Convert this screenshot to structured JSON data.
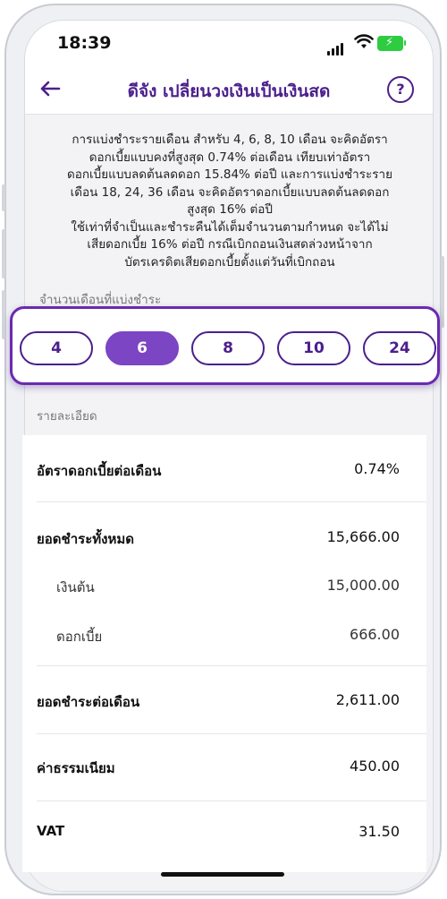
{
  "status": {
    "time": "18:39"
  },
  "nav": {
    "title": "ดีจัง เปลี่ยนวงเงินเป็นเงินสด",
    "help": "?"
  },
  "description": [
    "การแบ่งชำระรายเดือน สำหรับ 4, 6, 8, 10 เดือน จะคิดอัตรา",
    "ดอกเบี้ยแบบคงที่สูงสุด 0.74% ต่อเดือน เทียบเท่าอัตรา",
    "ดอกเบี้ยแบบลดต้นลดดอก 15.84% ต่อปี และการแบ่งชำระราย",
    "เดือน 18, 24, 36 เดือน จะคิดอัตราดอกเบี้ยแบบลดต้นลดดอก",
    "สูงสุด 16% ต่อปี",
    "ใช้เท่าที่จำเป็นและชำระคืนได้เต็มจำนวนตามกำหนด จะได้ไม่",
    "เสียดอกเบี้ย 16% ต่อปี กรณีเบิกถอนเงินสดล่วงหน้าจาก",
    "บัตรเครดิตเสียดอกเบี้ยตั้งแต่วันที่เบิกถอน"
  ],
  "months": {
    "label": "จำนวนเดือนที่แบ่งชำระ",
    "options": [
      "4",
      "6",
      "8",
      "10",
      "24"
    ],
    "selected": "6"
  },
  "details": {
    "label": "รายละเอียด",
    "rows": [
      {
        "key": "อัตราดอกเบี้ยต่อเดือน",
        "value": "0.74%"
      },
      {
        "key": "ยอดชำระทั้งหมด",
        "value": "15,666.00"
      },
      {
        "key": "เงินต้น",
        "value": "15,000.00"
      },
      {
        "key": "ดอกเบี้ย",
        "value": "666.00"
      },
      {
        "key": "ยอดชำระต่อเดือน",
        "value": "2,611.00"
      },
      {
        "key": "ค่าธรรมเนียม",
        "value": "450.00"
      },
      {
        "key": "VAT",
        "value": "31.50"
      }
    ]
  },
  "colors": {
    "brand": "#4b1f8c",
    "selected": "#7b45c4",
    "battery": "#2ecc40"
  }
}
